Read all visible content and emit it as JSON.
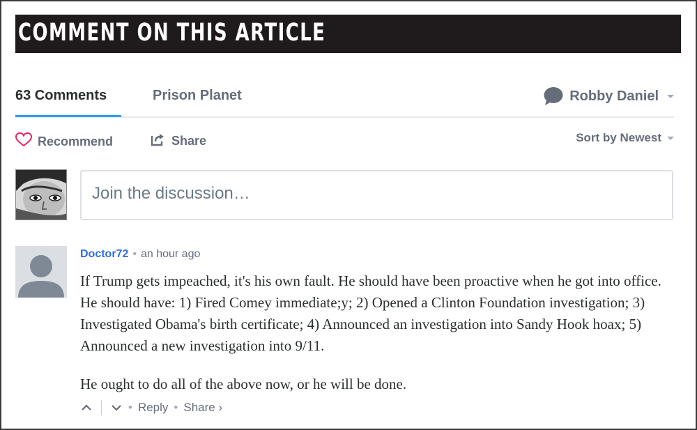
{
  "banner": {
    "title": "COMMENT ON THIS ARTICLE"
  },
  "tabs": {
    "comments": "63 Comments",
    "site": "Prison Planet"
  },
  "user": {
    "name": "Robby Daniel"
  },
  "actions": {
    "recommend": "Recommend",
    "share": "Share",
    "sort": "Sort by Newest"
  },
  "composer": {
    "placeholder": "Join the discussion…"
  },
  "comment": {
    "author": "Doctor72",
    "time": "an hour ago",
    "paragraphs": [
      "If Trump gets impeached, it's his own fault. He should have been proactive when he got into office. He should have: 1) Fired Comey immediate;y; 2) Opened a Clinton Foundation investigation; 3) Investigated Obama's birth certificate; 4) Announced an investigation into Sandy Hook hoax; 5) Announced a new investigation into 9/11.",
      "He ought to do all of the above now, or he will be done."
    ],
    "reply": "Reply",
    "share": "Share ›"
  },
  "colors": {
    "accent": "#2e9fff",
    "author": "#2e6fd8",
    "banner_bg": "#1f1b1c",
    "heart": "#e0245e"
  }
}
